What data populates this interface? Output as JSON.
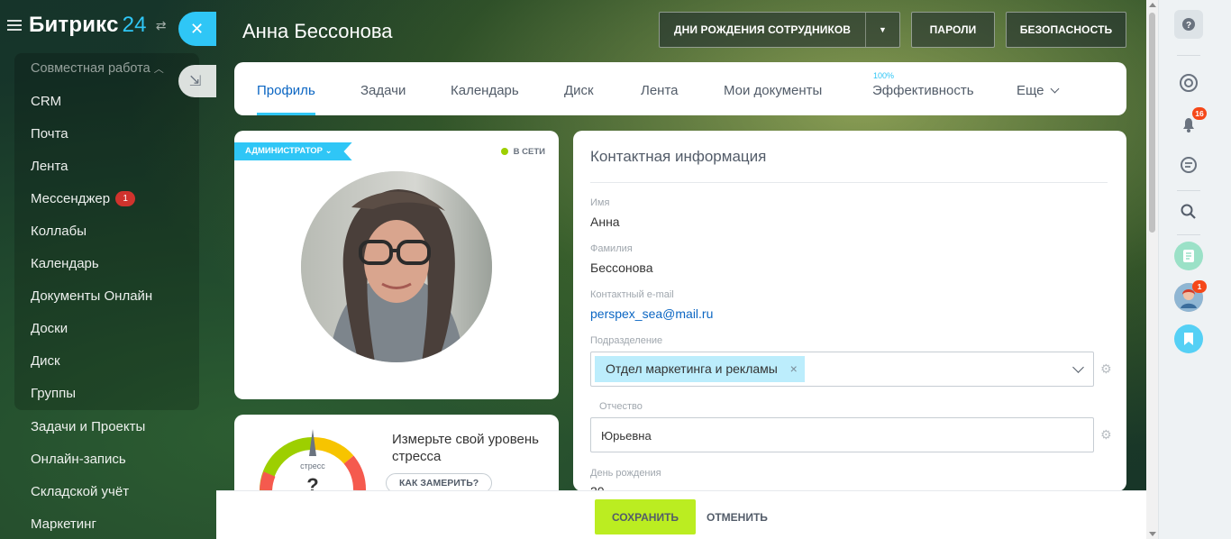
{
  "sidebar": {
    "logo_name": "Битрикс",
    "logo_num": "24",
    "group_label": "Совместная работа",
    "items": [
      {
        "label": "CRM"
      },
      {
        "label": "Почта"
      },
      {
        "label": "Лента"
      },
      {
        "label": "Мессенджер",
        "badge": "1"
      },
      {
        "label": "Коллабы"
      },
      {
        "label": "Календарь"
      },
      {
        "label": "Документы Онлайн"
      },
      {
        "label": "Доски"
      },
      {
        "label": "Диск"
      },
      {
        "label": "Группы"
      },
      {
        "label": "Задачи и Проекты"
      },
      {
        "label": "Онлайн-запись"
      },
      {
        "label": "Складской учёт"
      },
      {
        "label": "Маркетинг"
      }
    ]
  },
  "header": {
    "title": "Анна Бессонова",
    "buttons": {
      "birthdays": "ДНИ РОЖДЕНИЯ СОТРУДНИКОВ",
      "passwords": "ПАРОЛИ",
      "security": "БЕЗОПАСНОСТЬ"
    }
  },
  "tabs": {
    "items": [
      {
        "label": "Профиль",
        "active": true
      },
      {
        "label": "Задачи"
      },
      {
        "label": "Календарь"
      },
      {
        "label": "Диск"
      },
      {
        "label": "Лента"
      },
      {
        "label": "Мои документы"
      },
      {
        "label": "Эффективность"
      },
      {
        "label": "Еще"
      }
    ],
    "efficiency_percent": "100%"
  },
  "profile": {
    "role_tag": "АДМИНИСТРАТОР",
    "status": "В СЕТИ"
  },
  "stress": {
    "title": "Измерьте свой уровень стресса",
    "gauge_label": "стресс",
    "gauge_value": "?",
    "button": "КАК ЗАМЕРИТЬ?"
  },
  "contact": {
    "title": "Контактная информация",
    "first_name_label": "Имя",
    "first_name": "Анна",
    "last_name_label": "Фамилия",
    "last_name": "Бессонова",
    "email_label": "Контактный e-mail",
    "email": "perspex_sea@mail.ru",
    "department_label": "Подразделение",
    "department": "Отдел маркетинга и рекламы",
    "patronymic_label": "Отчество",
    "patronymic": "Юрьевна",
    "birthday_label": "День рождения",
    "birthday_partial": "20"
  },
  "footer": {
    "save": "СОХРАНИТЬ",
    "cancel": "ОТМЕНИТЬ"
  },
  "rightbar": {
    "notifications_count": "16",
    "avatar_badge": "1"
  },
  "colors": {
    "accent": "#2fc6f6",
    "link": "#0b66c3",
    "save_button": "#bbed21",
    "badge_red": "#d0332d"
  }
}
